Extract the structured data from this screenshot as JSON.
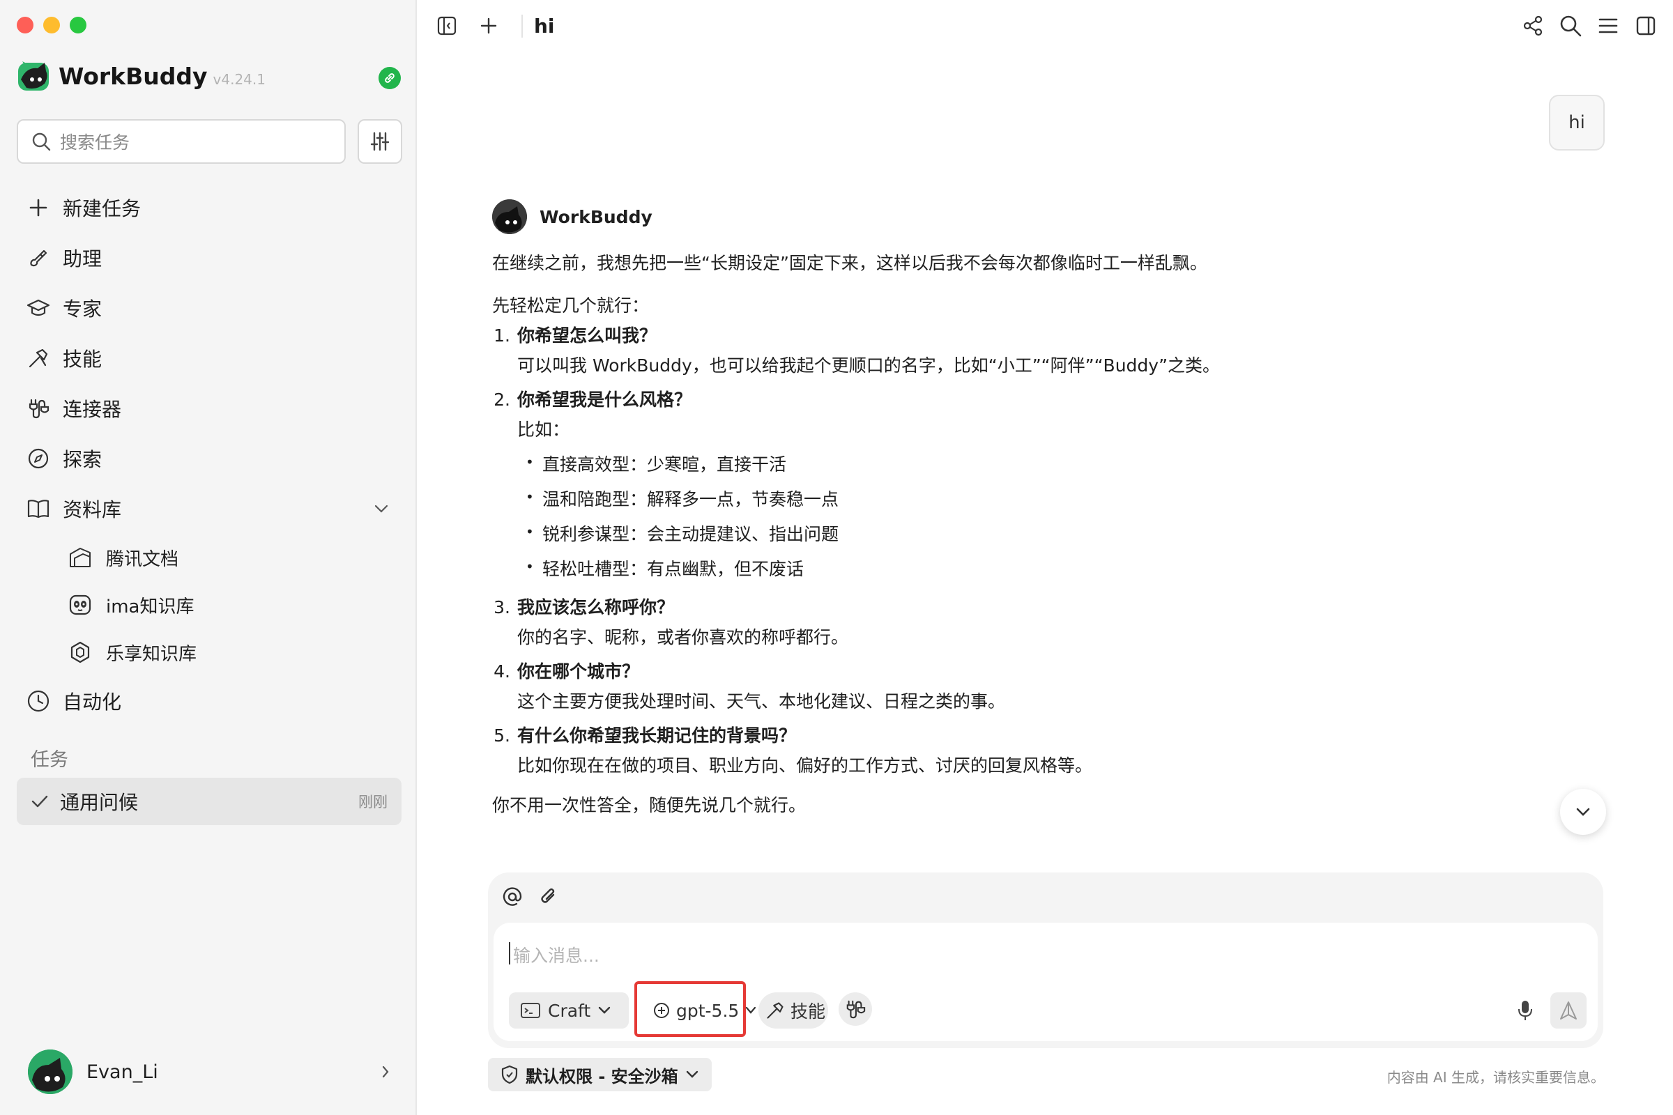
{
  "sidebar": {
    "app_name": "WorkBuddy",
    "version": "v4.24.1",
    "search_placeholder": "搜索任务",
    "nav": [
      {
        "label": "新建任务",
        "icon": "plus-icon"
      },
      {
        "label": "助理",
        "icon": "brush-icon"
      },
      {
        "label": "专家",
        "icon": "graduation-cap-icon"
      },
      {
        "label": "技能",
        "icon": "hammer-icon"
      },
      {
        "label": "连接器",
        "icon": "plug-icon"
      },
      {
        "label": "探索",
        "icon": "compass-icon"
      },
      {
        "label": "资料库",
        "icon": "book-icon"
      }
    ],
    "library_items": [
      {
        "label": "腾讯文档",
        "icon": "tencent-docs-icon"
      },
      {
        "label": "ima知识库",
        "icon": "panda-icon"
      },
      {
        "label": "乐享知识库",
        "icon": "hexagon-icon"
      }
    ],
    "automation": {
      "label": "自动化",
      "icon": "clock-icon"
    },
    "tasks_section": "任务",
    "tasks": [
      {
        "name": "通用问候",
        "time": "刚刚"
      }
    ],
    "user": {
      "name": "Evan_Li"
    }
  },
  "topbar": {
    "title": "hi"
  },
  "conversation": {
    "user_message": "hi",
    "bot_name": "WorkBuddy",
    "intro": "在继续之前，我想先把一些“长期设定”固定下来，这样以后我不会每次都像临时工一样乱飘。",
    "lead": "先轻松定几个就行：",
    "items": [
      {
        "num": "1.",
        "title": "你希望怎么叫我？",
        "desc": "可以叫我 WorkBuddy，也可以给我起个更顺口的名字，比如“小工”“阿伴”“Buddy”之类。"
      },
      {
        "num": "2.",
        "title": "你希望我是什么风格？",
        "desc": "比如：",
        "bullets": [
          "直接高效型：少寒暄，直接干活",
          "温和陪跑型：解释多一点，节奏稳一点",
          "锐利参谋型：会主动提建议、指出问题",
          "轻松吐槽型：有点幽默，但不废话"
        ]
      },
      {
        "num": "3.",
        "title": "我应该怎么称呼你？",
        "desc": "你的名字、昵称，或者你喜欢的称呼都行。"
      },
      {
        "num": "4.",
        "title": "你在哪个城市？",
        "desc": "这个主要方便我处理时间、天气、本地化建议、日程之类的事。"
      },
      {
        "num": "5.",
        "title": "有什么你希望我长期记住的背景吗？",
        "desc": "比如你现在在做的项目、职业方向、偏好的工作方式、讨厌的回复风格等。"
      }
    ],
    "closing": "你不用一次性答全，随便先说几个就行。"
  },
  "composer": {
    "placeholder": "输入消息...",
    "mode": "Craft",
    "model": "gpt-5.5",
    "skill_label": "技能",
    "permission": "默认权限 - 安全沙箱",
    "disclaimer": "内容由 AI 生成，请核实重要信息。"
  },
  "colors": {
    "accent_green": "#21b54b",
    "highlight_red": "#e53935"
  }
}
